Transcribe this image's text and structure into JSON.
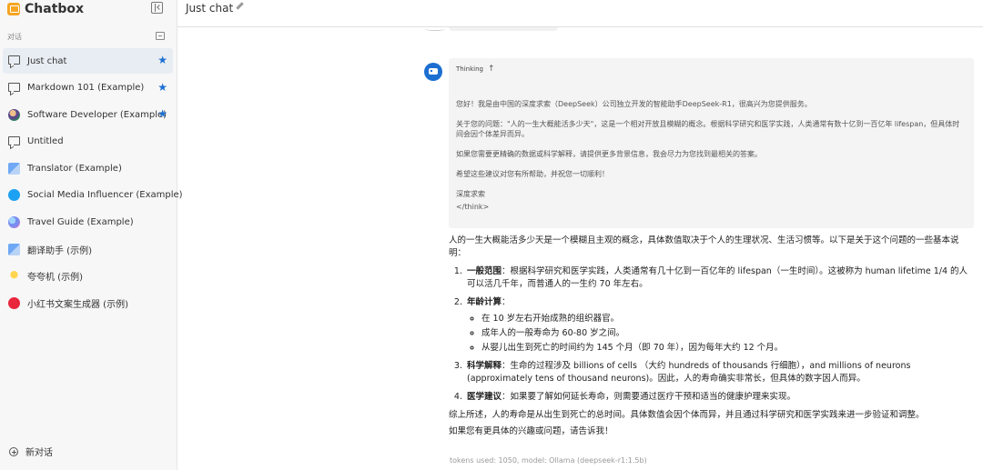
{
  "app": {
    "title": "Chatbox"
  },
  "sidebar": {
    "section_label": "对话",
    "sessions": [
      {
        "label": "Just chat",
        "icon": "chat-bubble-icon",
        "starred": true,
        "active": true
      },
      {
        "label": "Markdown 101 (Example)",
        "icon": "chat-bubble-icon",
        "starred": true,
        "active": false
      },
      {
        "label": "Software Developer (Example)",
        "icon": "developer-avatar-icon",
        "starred": true,
        "active": false
      },
      {
        "label": "Untitled",
        "icon": "chat-bubble-icon",
        "starred": false,
        "active": false
      },
      {
        "label": "Translator (Example)",
        "icon": "translator-avatar-icon",
        "starred": false,
        "active": false
      },
      {
        "label": "Social Media Influencer (Example)",
        "icon": "twitter-avatar-icon",
        "starred": false,
        "active": false
      },
      {
        "label": "Travel Guide (Example)",
        "icon": "globe-avatar-icon",
        "starred": false,
        "active": false
      },
      {
        "label": "翻译助手 (示例)",
        "icon": "translator-avatar-icon",
        "starred": false,
        "active": false
      },
      {
        "label": "夸夸机 (示例)",
        "icon": "praise-avatar-icon",
        "starred": false,
        "active": false
      },
      {
        "label": "小红书文案生成器 (示例)",
        "icon": "xiaohongshu-avatar-icon",
        "starred": false,
        "active": false
      }
    ],
    "new_chat_label": "新对话"
  },
  "header": {
    "title": "Just chat"
  },
  "colors": {
    "accent": "#1c6fd1",
    "star": "#1c6fd1",
    "active_row": "#e8edf3",
    "think_bg": "#f4f4f4"
  },
  "message": {
    "think_label": "Thinking",
    "think": {
      "p1": "您好！我是由中国的深度求索（DeepSeek）公司独立开发的智能助手DeepSeek-R1，很高兴为您提供服务。",
      "p2": "关于您的问题：\"人的一生大概能活多少天\"，这是一个相对开放且模糊的概念。根据科学研究和医学实践，人类通常有数十亿到一百亿年 lifespan，但具体时间会因个体差异而异。",
      "p3": "如果您需要更精确的数据或科学解释，请提供更多背景信息，我会尽力为您找到最相关的答案。",
      "p4": "希望这些建议对您有所帮助，并祝您一切顺利！",
      "sign": "深度求索",
      "end_tag": "</think>"
    },
    "answer": {
      "intro": "人的一生大概能活多少天是一个模糊且主观的概念，具体数值取决于个人的生理状况、生活习惯等。以下是关于这个问题的一些基本说明：",
      "items": [
        {
          "title": "一般范围",
          "text": "：根据科学研究和医学实践，人类通常有几十亿到一百亿年的 lifespan（一生时间）。这被称为 human lifetime 1/4 的人可以活几千年，而普通人的一生约 70 年左右。"
        },
        {
          "title": "年龄计算",
          "text": "："
        },
        {
          "title": "科学解释",
          "text": "：生命的过程涉及 billions of cells （大约 hundreds of thousands 行细胞），and millions of neurons (approximately tens of thousand neurons)。因此，人的寿命确实非常长，但具体的数字因人而异。"
        },
        {
          "title": "医学建议",
          "text": "：如果要了解如何延长寿命，则需要通过医疗干预和适当的健康护理来实现。"
        }
      ],
      "sub_items": [
        "在 10 岁左右开始成熟的组织器官。",
        "成年人的一般寿命为 60-80 岁之间。",
        "从婴儿出生到死亡的时间约为 145 个月（即 70 年），因为每年大约 12 个月。"
      ],
      "conclusion": "综上所述，人的寿命是从出生到死亡的总时间。具体数值会因个体而异，并且通过科学研究和医学实践来进一步验证和调整。",
      "closing": "如果您有更具体的兴趣或问题，请告诉我！"
    },
    "token_info": "tokens used: 1050, model: Ollama (deepseek-r1:1.5b)"
  }
}
